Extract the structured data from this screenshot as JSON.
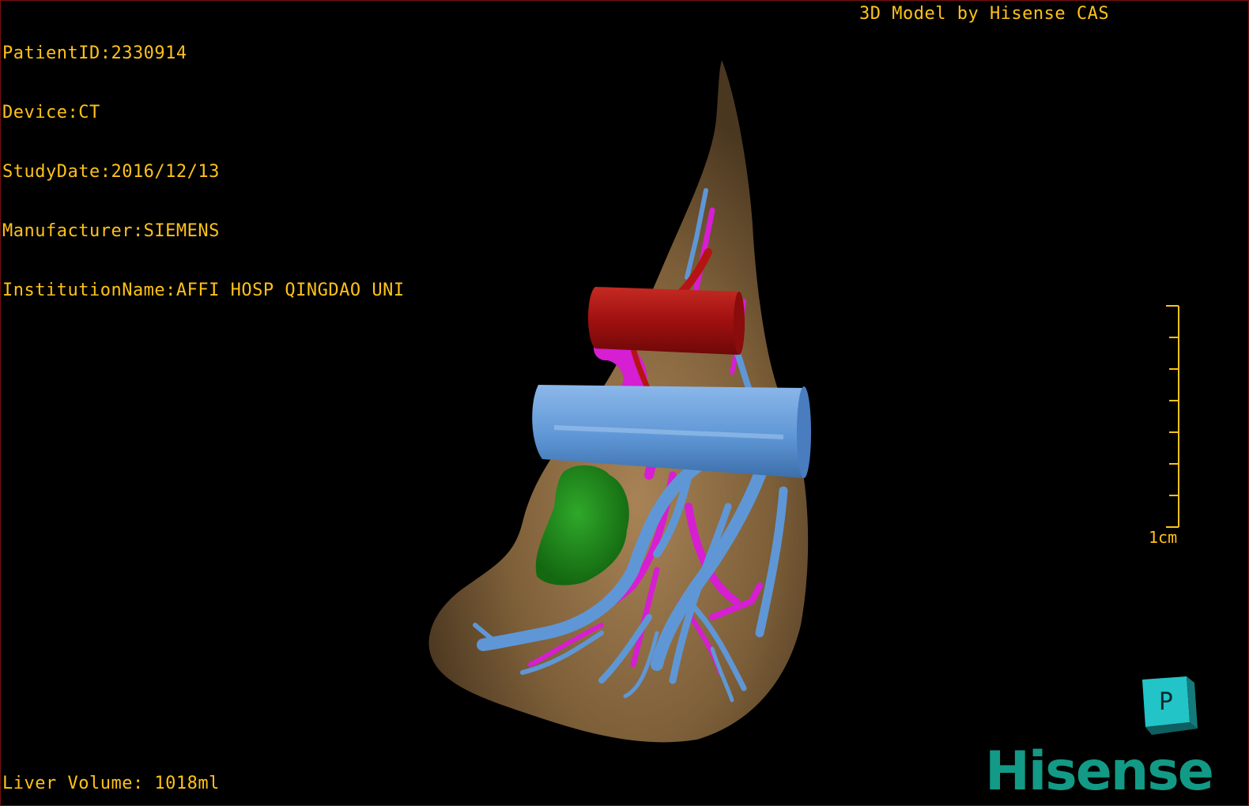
{
  "patient_info": {
    "patient_id": "PatientID:2330914",
    "device": "Device:CT",
    "study_date": "StudyDate:2016/12/13",
    "manufacturer": "Manufacturer:SIEMENS",
    "institution": "InstitutionName:AFFI HOSP QINGDAO UNI"
  },
  "model_credit": "3D Model by Hisense CAS",
  "liver_volume": "Liver Volume: 1018ml",
  "scale": {
    "label": "1cm"
  },
  "orientation_cube": {
    "face_label": "P"
  },
  "brand": {
    "logo_text": "Hisense"
  },
  "colors": {
    "text": "#ffc21a",
    "liver": "#8a6a42",
    "portal_vein": "#5f97d6",
    "artery": "#b51414",
    "hepatic_vein": "#d61ed2",
    "tumor": "#1f8a1a",
    "brand": "#129a86",
    "cube": "#22c4c8"
  }
}
